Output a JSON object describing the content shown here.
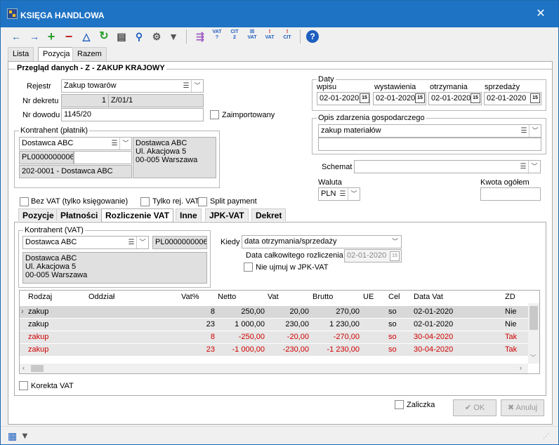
{
  "window": {
    "title": "KSIĘGA HANDLOWA",
    "close": "✕"
  },
  "toolbar": {
    "icons": [
      "back-arrow",
      "forward-arrow",
      "add",
      "remove",
      "delta",
      "refresh",
      "print",
      "search",
      "settings",
      "filter"
    ],
    "text_icons": [
      {
        "top": "VAT",
        "bottom": "?"
      },
      {
        "top": "CIT",
        "bottom": "2"
      },
      {
        "top": "☒",
        "bottom": "VAT"
      },
      {
        "top": "!",
        "bottom": "VAT"
      },
      {
        "top": "!",
        "bottom": "CIT"
      }
    ],
    "help": "?"
  },
  "top_tabs": [
    "Lista",
    "Pozycja",
    "Razem"
  ],
  "header": {
    "title": "Przegląd danych - Z - ZAKUP KRAJOWY"
  },
  "rejestr": {
    "label": "Rejestr",
    "value": "Zakup towarów"
  },
  "nr_dekretu": {
    "label": "Nr dekretu",
    "num": "1",
    "value": "Z/01/1"
  },
  "nr_dowodu": {
    "label": "Nr dowodu",
    "value": "1145/20"
  },
  "zaimportowany": "Zaimportowany",
  "kontrahent_platnik": {
    "label": "Kontrahent (płatnik)",
    "name": "Dostawca ABC",
    "nip": "PL0000000006",
    "code": "202-0001 - Dostawca ABC",
    "addr1": "Dostawca ABC",
    "addr2": "Ul. Akacjowa 5",
    "addr3": "00-005 Warszawa"
  },
  "daty": {
    "label": "Daty",
    "wpisu_label": "wpisu",
    "wystawienia_label": "wystawienia",
    "otrzymania_label": "otrzymania",
    "sprzedazy_label": "sprzedaży",
    "wpisu": "02-01-2020",
    "wystawienia": "02-01-2020",
    "otrzymania": "02-01-2020",
    "sprzedazy": "02-01-2020",
    "cal_icon": "15"
  },
  "opis": {
    "label": "Opis zdarzenia gospodarczego",
    "value": "zakup materiałów"
  },
  "schemat": {
    "label": "Schemat",
    "value": ""
  },
  "waluta": {
    "label": "Waluta",
    "value": "PLN"
  },
  "kwota": {
    "label": "Kwota ogółem",
    "value": ""
  },
  "checks": {
    "bez_vat": "Bez VAT (tylko księgowanie)",
    "tylko_rej": "Tylko rej. VAT",
    "split": "Split payment"
  },
  "content_tabs": [
    "Pozycje",
    "Płatności",
    "Rozliczenie VAT",
    "Inne",
    "JPK-VAT",
    "Dekret"
  ],
  "kontrahent_vat": {
    "label": "Kontrahent (VAT)",
    "name": "Dostawca ABC",
    "nip": "PL0000000006",
    "addr1": "Dostawca ABC",
    "addr2": "Ul. Akacjowa 5",
    "addr3": "00-005 Warszawa"
  },
  "kiedy": {
    "label": "Kiedy",
    "value": "data otrzymania/sprzedaży"
  },
  "data_rozliczenia": {
    "label": "Data całkowitego rozliczenia",
    "value": "02-01-2020"
  },
  "nie_ujmuj": "Nie ujmuj w JPK-VAT",
  "grid": {
    "columns": [
      "Rodzaj",
      "Oddział",
      "Vat%",
      "Netto",
      "Vat",
      "Brutto",
      "UE",
      "Cel",
      "Data Vat",
      "ZD"
    ],
    "rows": [
      {
        "rodzaj": "zakup",
        "oddzial": "",
        "vatp": "8",
        "netto": "250,00",
        "vat": "20,00",
        "brutto": "270,00",
        "ue": "",
        "cel": "so",
        "data": "02-01-2020",
        "zd": "Nie"
      },
      {
        "rodzaj": "zakup",
        "oddzial": "",
        "vatp": "23",
        "netto": "1 000,00",
        "vat": "230,00",
        "brutto": "1 230,00",
        "ue": "",
        "cel": "so",
        "data": "02-01-2020",
        "zd": "Nie"
      },
      {
        "rodzaj": "zakup",
        "oddzial": "",
        "vatp": "8",
        "netto": "-250,00",
        "vat": "-20,00",
        "brutto": "-270,00",
        "ue": "",
        "cel": "so",
        "data": "30-04-2020",
        "zd": "Tak"
      },
      {
        "rodzaj": "zakup",
        "oddzial": "",
        "vatp": "23",
        "netto": "-1 000,00",
        "vat": "-230,00",
        "brutto": "-1 230,00",
        "ue": "",
        "cel": "so",
        "data": "30-04-2020",
        "zd": "Tak"
      }
    ],
    "red_color": "#d00000"
  },
  "korekta": "Korekta VAT",
  "zaliczka": "Zaliczka",
  "buttons": {
    "ok": "OK",
    "anuluj": "Anuluj"
  }
}
